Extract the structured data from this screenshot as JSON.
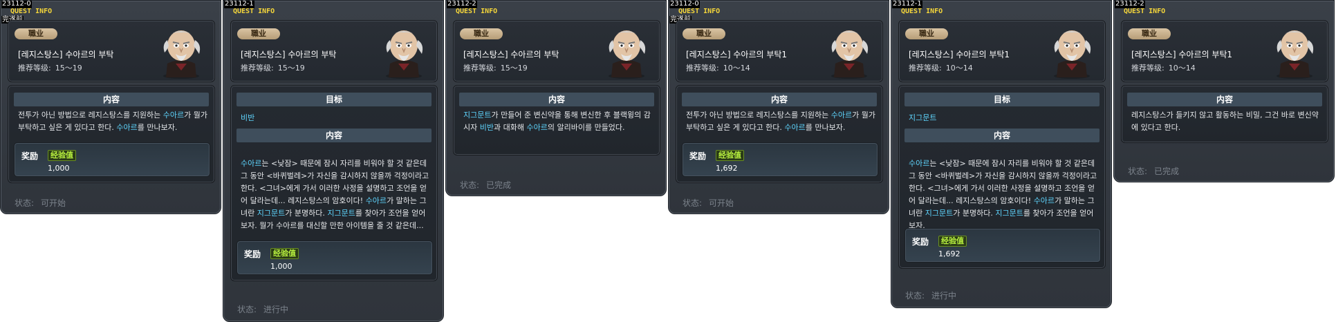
{
  "panels": [
    {
      "id": "23112-0",
      "title": "QUEST INFO",
      "sub": "完遂前",
      "job_badge": "職业",
      "quest_name": "[레지스탕스] 수아르의 부탁",
      "level_label": "推荐等级:",
      "level_value": "15～19",
      "content_head": "内容",
      "content_parts": [
        {
          "t": "전투가 아닌 방법으로 레지스탕스를 지원하는 "
        },
        {
          "t": "수아르",
          "hl": true
        },
        {
          "t": "가 뭘가 부탁하고 싶은 게 있다고 한다. "
        },
        {
          "t": "수아르",
          "hl": true
        },
        {
          "t": "를 만나보자."
        }
      ],
      "reward_label": "奖励",
      "exp_label": "经验值",
      "exp_value": "1,000",
      "status_label": "状态:",
      "status_value": "可开始"
    },
    {
      "id": "23112-1",
      "title": "QUEST INFO",
      "job_badge": "職业",
      "quest_name": "[레지스탕스] 수아르의 부탁",
      "level_label": "推荐等级:",
      "level_value": "15～19",
      "target_head": "目标",
      "target_value": "비반",
      "content_head": "内容",
      "content_parts": [
        {
          "t": "수아르",
          "hl": true
        },
        {
          "t": "는 <낮잠> 때문에 잠시 자리를 비워야 할 것 같은데 그 동안 <바퀴벌레>가 자신을 감시하지 않을까 걱정이라고 한다. <그녀>에게 가서 이러한 사정을 설명하고 조언을 얻어 달라는데... 레지스탕스의 암호이다! "
        },
        {
          "t": "수아르",
          "hl": true
        },
        {
          "t": "가 말하는 그녀란 "
        },
        {
          "t": "지그문트",
          "hl": true
        },
        {
          "t": "가 분명하다. "
        },
        {
          "t": "지그문트",
          "hl": true
        },
        {
          "t": "를 찾아가 조언을 얻어보자. 뭘가 수아르를 대신할 만한 아이템을 줄 것 같은데..."
        }
      ],
      "reward_label": "奖励",
      "exp_label": "经验值",
      "exp_value": "1,000",
      "status_label": "状态:",
      "status_value": "进行中"
    },
    {
      "id": "23112-2",
      "title": "QUEST INFO",
      "job_badge": "職业",
      "quest_name": "[레지스탕스] 수아르의 부탁",
      "level_label": "推荐等级:",
      "level_value": "15～19",
      "content_head": "内容",
      "content_parts": [
        {
          "t": "지그문트",
          "hl": true
        },
        {
          "t": "가 만들어 준 변신약을 통해 변신한 후 블랙윙의 감시자 "
        },
        {
          "t": "비반",
          "hl": true
        },
        {
          "t": "과 대화해 "
        },
        {
          "t": "수아르",
          "hl": true
        },
        {
          "t": "의 알리바이를 만들었다."
        }
      ],
      "status_label": "状态:",
      "status_value": "已完成"
    },
    {
      "id": "23112-0",
      "title": "QUEST INFO",
      "sub": "完遂前",
      "job_badge": "職业",
      "quest_name": "[레지스탕스] 수아르의 부탁1",
      "level_label": "推荐等级:",
      "level_value": "10～14",
      "content_head": "内容",
      "content_parts": [
        {
          "t": "전투가 아닌 방법으로 레지스탕스를 지원하는 "
        },
        {
          "t": "수아르",
          "hl": true
        },
        {
          "t": "가 뭘가 부탁하고 싶은 게 있다고 한다. "
        },
        {
          "t": "수아르",
          "hl": true
        },
        {
          "t": "를 만나보자."
        }
      ],
      "reward_label": "奖励",
      "exp_label": "经验值",
      "exp_value": "1,692",
      "status_label": "状态:",
      "status_value": "可开始"
    },
    {
      "id": "23112-1",
      "title": "QUEST INFO",
      "job_badge": "職业",
      "quest_name": "[레지스탕스] 수아르의 부탁1",
      "level_label": "推荐等级:",
      "level_value": "10～14",
      "target_head": "目标",
      "target_value": "지그문트",
      "content_head": "内容",
      "content_parts": [
        {
          "t": "수아르",
          "hl": true
        },
        {
          "t": "는 <낮잠> 때문에 잠시 자리를 비워야 할 것 같은데 그 동안 <바퀴벌레>가 자신을 감시하지 않을까 걱정이라고 한다. <그녀>에게 가서 이러한 사정을 설명하고 조언을 얻어 달라는데... 레지스탕스의 암호이다! "
        },
        {
          "t": "수아르",
          "hl": true
        },
        {
          "t": "가 말하는 그녀란 "
        },
        {
          "t": "지그문트",
          "hl": true
        },
        {
          "t": "가 분명하다. "
        },
        {
          "t": "지그문트",
          "hl": true
        },
        {
          "t": "를 찾아가 조언을 얻어보자."
        }
      ],
      "reward_label": "奖励",
      "exp_label": "经验值",
      "exp_value": "1,692",
      "status_label": "状态:",
      "status_value": "进行中"
    },
    {
      "id": "23112-2",
      "title": "QUEST INFO",
      "job_badge": "職业",
      "quest_name": "[레지스탕스] 수아르의 부탁1",
      "level_label": "推荐等级:",
      "level_value": "10～14",
      "content_head": "内容",
      "content_parts": [
        {
          "t": "레지스탕스가 들키지 않고 활동하는 비밀, 그건 바로 변신약에 있다고 한다."
        }
      ],
      "status_label": "状态:",
      "status_value": "已完成"
    }
  ]
}
